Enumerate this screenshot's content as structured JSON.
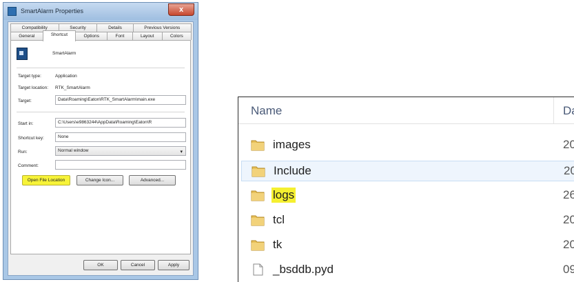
{
  "dialog": {
    "title": "SmartAlarm Properties",
    "close_label": "x",
    "tabs_row1": [
      "Compatibility",
      "Security",
      "Details",
      "Previous Versions"
    ],
    "tabs_row2": [
      "General",
      "Shortcut",
      "Options",
      "Font",
      "Layout",
      "Colors"
    ],
    "active_tab": "Shortcut",
    "app_name": "SmartAlarm",
    "fields": {
      "target_type_label": "Target type:",
      "target_type_value": "Application",
      "target_location_label": "Target location:",
      "target_location_value": "RTK_SmartAlarm",
      "target_label": "Target:",
      "target_value": "Data\\Roaming\\Eaton\\RTK_SmartAlarm\\main.exe",
      "start_in_label": "Start in:",
      "start_in_value": "C:\\Users\\e9863244\\AppData\\Roaming\\Eaton\\R",
      "shortcut_key_label": "Shortcut key:",
      "shortcut_key_value": "None",
      "run_label": "Run:",
      "run_value": "Normal window",
      "comment_label": "Comment:",
      "comment_value": ""
    },
    "buttons": {
      "open_file_location": "Open File Location",
      "change_icon": "Change Icon...",
      "advanced": "Advanced...",
      "ok": "OK",
      "cancel": "Cancel",
      "apply": "Apply"
    },
    "highlight_color": "#f7f338"
  },
  "explorer": {
    "columns": {
      "name": "Name",
      "date": "Da"
    },
    "rows": [
      {
        "name": "images",
        "type": "folder",
        "date": "20"
      },
      {
        "name": "Include",
        "type": "folder",
        "date": "20",
        "selected": true
      },
      {
        "name": "logs",
        "type": "folder",
        "date": "26",
        "highlighted": true
      },
      {
        "name": "tcl",
        "type": "folder",
        "date": "20"
      },
      {
        "name": "tk",
        "type": "folder",
        "date": "20"
      },
      {
        "name": "_bsddb.pyd",
        "type": "file",
        "date": "09"
      }
    ],
    "highlight_color": "#f5f030",
    "folder_icon": "folder-icon",
    "file_icon": "file-icon"
  }
}
